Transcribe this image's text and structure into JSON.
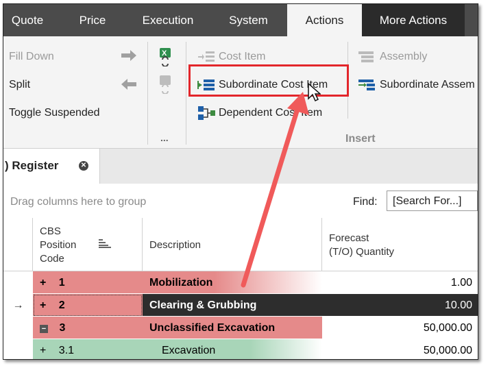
{
  "tabs": [
    "Quote",
    "Price",
    "Execution",
    "System",
    "Actions",
    "More Actions"
  ],
  "ribbon": {
    "fill_down": "Fill Down",
    "split": "Split",
    "toggle_suspended": "Toggle Suspended",
    "more": "...",
    "cost_item": "Cost Item",
    "subordinate_cost_item": "Subordinate Cost Item",
    "dependent_cost_item": "Dependent Cost Item",
    "assembly": "Assembly",
    "subordinate_assembly": "Subordinate Assem",
    "insert_group": "Insert"
  },
  "document_tab": {
    "title": ") Register"
  },
  "grid": {
    "group_hint": "Drag columns here to group",
    "find_label": "Find:",
    "find_placeholder": "[Search For...]",
    "headers": {
      "cbs_line1": "CBS",
      "cbs_line2": "Position",
      "cbs_line3": "Code",
      "description": "Description",
      "forecast_line1": "Forecast",
      "forecast_line2": "(T/O) Quantity"
    },
    "rows": [
      {
        "expander": "+",
        "code": "1",
        "description": "Mobilization",
        "quantity": "1.00"
      },
      {
        "indicator": "→",
        "expander": "+",
        "code": "2",
        "description": "Clearing & Grubbing",
        "quantity": "10.00"
      },
      {
        "expander": "−",
        "code": "3",
        "description": "Unclassified Excavation",
        "quantity": "50,000.00"
      },
      {
        "expander": "+",
        "code": "3.1",
        "description": "Excavation",
        "quantity": "50,000.00"
      }
    ]
  },
  "colors": {
    "highlight_box": "#e3262b",
    "arrow": "#f05a5a",
    "row_red": "#e58a8a",
    "row_green": "#a8d5b8",
    "selected_row": "#2d2d2d"
  }
}
